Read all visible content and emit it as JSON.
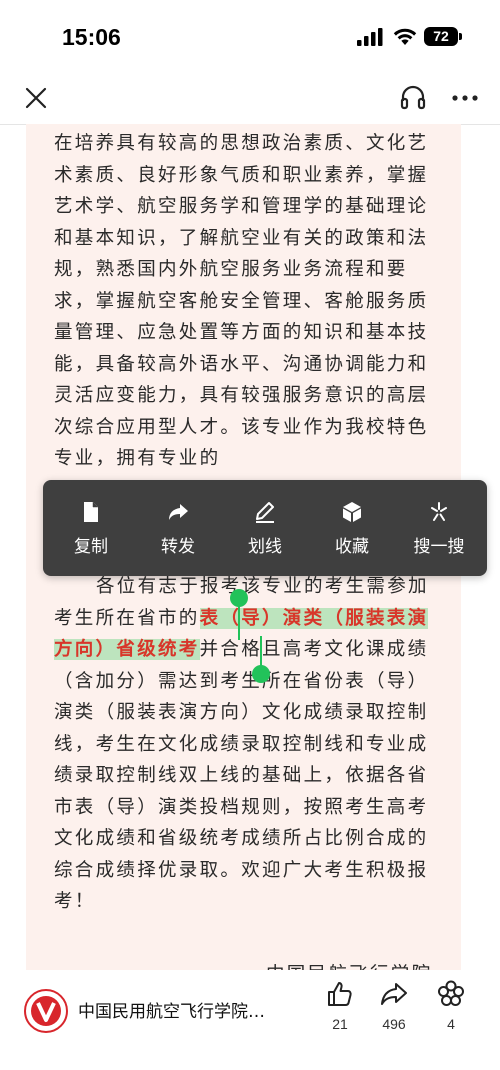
{
  "status_bar": {
    "time": "15:06",
    "battery": "72"
  },
  "nav": {
    "close_icon": "close-icon",
    "listen_icon": "headphones-icon",
    "more_icon": "more-icon"
  },
  "article": {
    "p1": "在培养具有较高的思想政治素质、文化艺术素质、良好形象气质和职业素养，掌握艺术学、航空服务学和管理学的基础理论和基本知识，了解航空业有关的政策和法规，熟悉国内外航空服务业务流程和要求，掌握航空客舱安全管理、客舱服务质量管理、应急处置等方面的知识和基本技能，具备较高外语水平、沟通协调能力和灵活应变能力，具有较强服务意识的高层次综合应用型人才。该专业作为我校特色专业，拥有专业的",
    "p2_before": "各位有志于报考该专业的考生需参加考生所在省市的",
    "p2_highlight": "表（导）演类（服装表演方向）省级统考",
    "p2_after": "并合格且高考文化课成绩（含加分）需达到考生所在省份表（导）演类（服装表演方向）文化成绩录取控制线，考生在文化成绩录取控制线和专业成绩录取控制线双上线的基础上，依据各省市表（导）演类投档规则，按照考生高考文化成绩和省级统考成绩所占比例合成的综合成绩择优录取。欢迎广大考生积极报考！",
    "signature_partial": "中国民航飞行学院"
  },
  "context_menu": [
    {
      "label": "复制",
      "icon": "document-icon"
    },
    {
      "label": "转发",
      "icon": "share-arrow-icon"
    },
    {
      "label": "划线",
      "icon": "pen-underline-icon"
    },
    {
      "label": "收藏",
      "icon": "cube-icon"
    },
    {
      "label": "搜一搜",
      "icon": "sparkle-icon"
    }
  ],
  "bottom_bar": {
    "source_name": "中国民用航空飞行学院…",
    "like_count": "21",
    "share_count": "496",
    "wow_count": "4"
  },
  "colors": {
    "highlight_bg": "#bde4be",
    "highlight_text": "#d8362a",
    "handle": "#22c25a",
    "menu_bg": "#3f3f3f",
    "article_bg": "#fdf1ed"
  }
}
